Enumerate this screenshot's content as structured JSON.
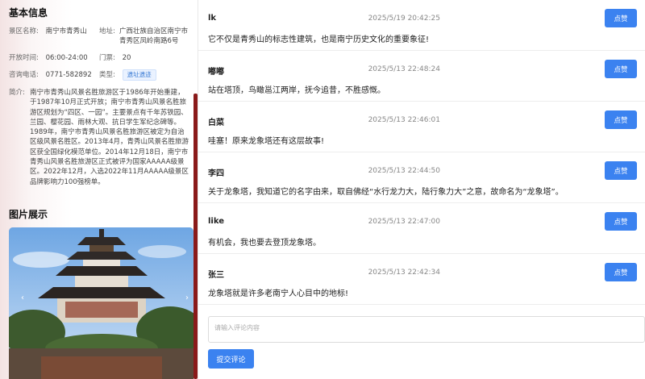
{
  "info": {
    "title": "基本信息",
    "scenic_label": "景区名称:",
    "scenic_value": "南宁市青秀山",
    "address_label": "地址:",
    "address_line1": "广西壮族自治区南宁市",
    "address_line2": "青秀区凤岭南路6号",
    "hours_label": "开放时间:",
    "hours_value": "06:00-24:00",
    "ticket_label": "门票:",
    "ticket_value": "20",
    "phone_label": "咨询电话:",
    "phone_value": "0771-582892",
    "type_label": "类型:",
    "type_value": "遗址遗迹",
    "intro_label": "简介:",
    "intro_text": "南宁市青秀山风景名胜旅游区于1986年开始重建，于1987年10月正式开放；南宁市青秀山风景名胜旅游区规划为“四区、一园”。主要景点有千年苏铁园、兰园、樱花园、雨林大观、抗日学生军纪念碑等。1989年，南宁市青秀山风景名胜旅游区被定为自治区级风景名胜区。2013年4月，青秀山风景名胜旅游区获全国绿化模范单位。2014年12月18日，南宁市青秀山风景名胜旅游区正式被评为国家AAAAA级景区。2022年12月，入选2022年11月AAAAA级景区品牌影响力100强榜单。"
  },
  "gallery": {
    "title": "图片展示",
    "prev": "‹",
    "next": "›"
  },
  "comments": [
    {
      "user": "lk",
      "time": "2025/5/19 20:42:25",
      "text": "它不仅是青秀山的标志性建筑，也是南宁历史文化的重要象征!",
      "like": "点赞"
    },
    {
      "user": "嘟嘟",
      "time": "2025/5/13 22:48:24",
      "text": "站在塔顶，鸟瞰邕江两岸，抚今追昔，不胜感慨。",
      "like": "点赞"
    },
    {
      "user": "白菜",
      "time": "2025/5/13 22:46:01",
      "text": "哇塞！原来龙象塔还有这层故事!",
      "like": "点赞"
    },
    {
      "user": "李四",
      "time": "2025/5/13 22:44:50",
      "text": "关于龙象塔，我知道它的名字由来，取自佛经“水行龙力大，陆行象力大”之意，故命名为“龙象塔”。",
      "like": "点赞"
    },
    {
      "user": "like",
      "time": "2025/5/13 22:47:00",
      "text": "有机会，我也要去登顶龙象塔。",
      "like": "点赞"
    },
    {
      "user": "张三",
      "time": "2025/5/13 22:42:34",
      "text": "龙象塔就是许多老南宁人心目中的地标!",
      "like": "点赞"
    }
  ],
  "form": {
    "placeholder": "请输入评论内容",
    "submit": "提交评论"
  }
}
